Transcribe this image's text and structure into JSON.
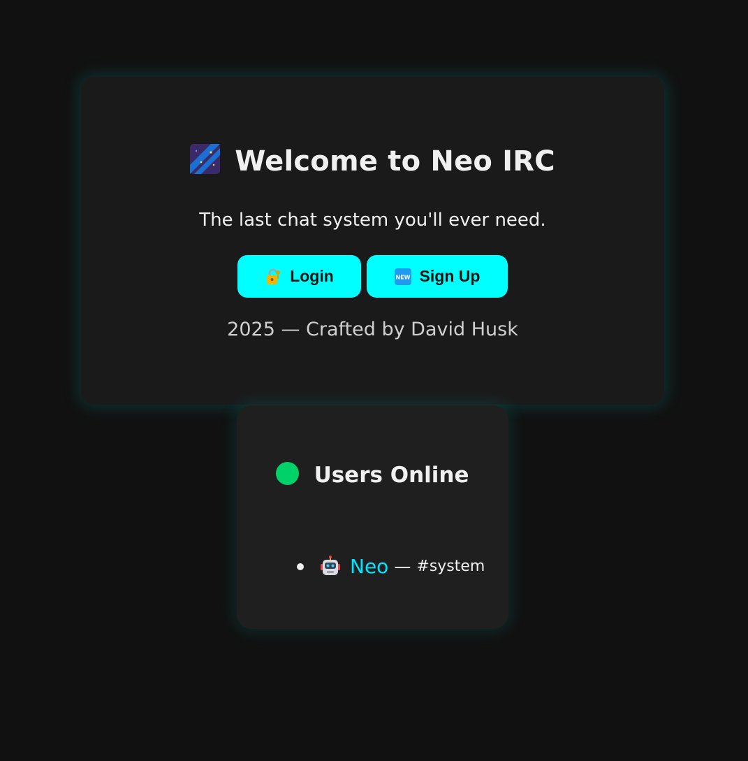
{
  "welcome": {
    "title_icon": "shooting-star-icon",
    "title": "Welcome to Neo IRC",
    "subtitle": "The last chat system you'll ever need.",
    "login_icon": "lock-with-key-icon",
    "login_label": "Login",
    "signup_icon": "new-badge-icon",
    "signup_label": "Sign Up",
    "credit": "2025 — Crafted by David Husk"
  },
  "users_online": {
    "status_icon": "green-circle-icon",
    "title": "Users Online",
    "users": [
      {
        "icon": "robot-icon",
        "name": "Neo",
        "separator": "—",
        "channel": "#system"
      }
    ]
  },
  "colors": {
    "accent": "#00ffff",
    "background": "#111111",
    "card": "#1a1a1a",
    "online": "#00d26a",
    "username": "#00e5ff"
  }
}
